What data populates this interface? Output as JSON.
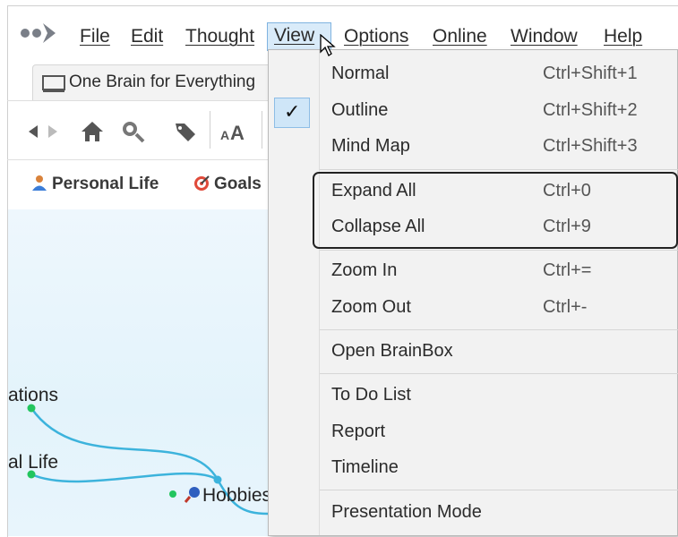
{
  "menubar": {
    "items": [
      {
        "label": "File"
      },
      {
        "label": "Edit"
      },
      {
        "label": "Thought"
      },
      {
        "label": "View"
      },
      {
        "label": "Options"
      },
      {
        "label": "Online"
      },
      {
        "label": "Window"
      },
      {
        "label": "Help"
      }
    ],
    "active": "View"
  },
  "tab": {
    "label": "One Brain for Everything"
  },
  "pins": [
    {
      "label": "Personal Life",
      "icon": "person-icon"
    },
    {
      "label": "Goals",
      "icon": "target-icon"
    }
  ],
  "map": {
    "nodes": [
      "ations",
      "al Life",
      "Hobbies"
    ],
    "link_color": "#3cb3dc",
    "node_color": "#22c55e"
  },
  "view_menu": {
    "items": [
      {
        "label": "Normal",
        "shortcut": "Ctrl+Shift+1"
      },
      {
        "label": "Outline",
        "shortcut": "Ctrl+Shift+2",
        "checked": true
      },
      {
        "label": "Mind Map",
        "shortcut": "Ctrl+Shift+3"
      },
      {
        "label": "Expand All",
        "shortcut": "Ctrl+0"
      },
      {
        "label": "Collapse All",
        "shortcut": "Ctrl+9"
      },
      {
        "label": "Zoom In",
        "shortcut": "Ctrl+="
      },
      {
        "label": "Zoom Out",
        "shortcut": "Ctrl+-"
      },
      {
        "label": "Open BrainBox",
        "shortcut": ""
      },
      {
        "label": "To Do List",
        "shortcut": ""
      },
      {
        "label": "Report",
        "shortcut": ""
      },
      {
        "label": "Timeline",
        "shortcut": ""
      },
      {
        "label": "Presentation Mode",
        "shortcut": ""
      }
    ],
    "check_mark": "✓"
  },
  "colors": {
    "menu_active_bg": "#d9ebf9",
    "accent": "#3cb3dc",
    "menu_bg": "#f2f2f2"
  }
}
